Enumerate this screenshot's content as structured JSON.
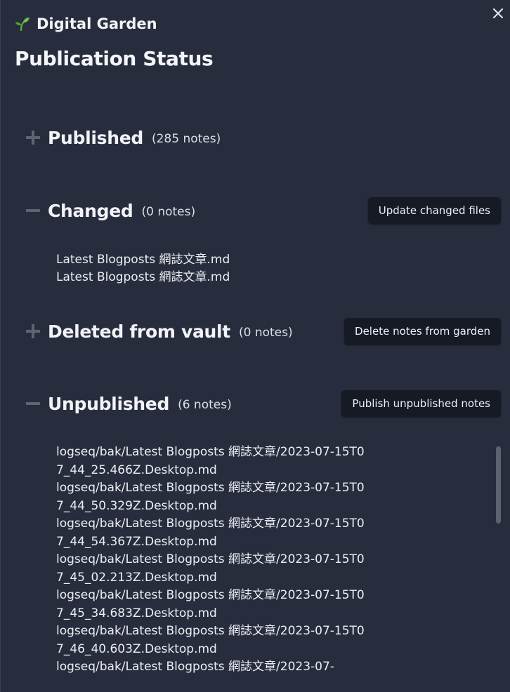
{
  "app": {
    "name": "Digital Garden",
    "logo_icon": "sprout-icon"
  },
  "title": "Publication Status",
  "sections": {
    "published": {
      "title": "Published",
      "count": "(285 notes)",
      "expanded": false
    },
    "changed": {
      "title": "Changed",
      "count": "(0 notes)",
      "expanded": true,
      "button": "Update changed files",
      "items": [
        "Latest Blogposts 網誌文章.md",
        "Latest Blogposts 網誌文章.md"
      ]
    },
    "deleted": {
      "title": "Deleted from vault",
      "count": "(0 notes)",
      "expanded": false,
      "button": "Delete notes from garden"
    },
    "unpublished": {
      "title": "Unpublished",
      "count": "(6 notes)",
      "expanded": true,
      "button": "Publish unpublished notes",
      "items": [
        "logseq/bak/Latest Blogposts 網誌文章/2023-07-15T07_44_25.466Z.Desktop.md",
        "logseq/bak/Latest Blogposts 網誌文章/2023-07-15T07_44_50.329Z.Desktop.md",
        "logseq/bak/Latest Blogposts 網誌文章/2023-07-15T07_44_54.367Z.Desktop.md",
        "logseq/bak/Latest Blogposts 網誌文章/2023-07-15T07_45_02.213Z.Desktop.md",
        "logseq/bak/Latest Blogposts 網誌文章/2023-07-15T07_45_34.683Z.Desktop.md",
        "logseq/bak/Latest Blogposts 網誌文章/2023-07-15T07_46_40.603Z.Desktop.md",
        "logseq/bak/Latest Blogposts 網誌文章/2023-07-"
      ]
    }
  },
  "colors": {
    "background": "#282d3e",
    "button_bg": "#161a24",
    "logo_green": "#5fb236"
  }
}
